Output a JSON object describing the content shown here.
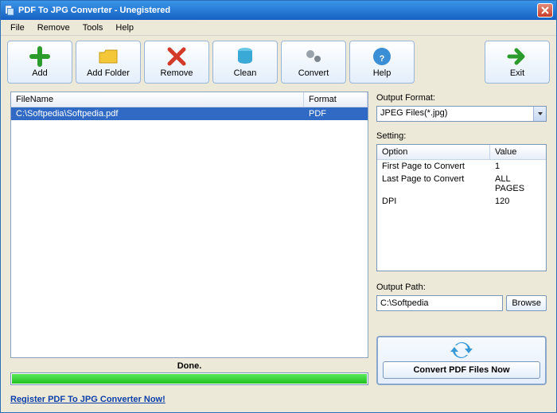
{
  "window": {
    "title": "PDF To JPG Converter - Unegistered"
  },
  "menu": {
    "file": "File",
    "remove": "Remove",
    "tools": "Tools",
    "help": "Help"
  },
  "toolbar": {
    "add": "Add",
    "addFolder": "Add Folder",
    "remove": "Remove",
    "clean": "Clean",
    "convert": "Convert",
    "help": "Help",
    "exit": "Exit"
  },
  "filetable": {
    "headers": {
      "filename": "FileName",
      "format": "Format"
    },
    "rows": [
      {
        "filename": "C:\\Softpedia\\Softpedia.pdf",
        "format": "PDF"
      }
    ]
  },
  "status": "Done.",
  "outputFormat": {
    "label": "Output Format:",
    "value": "JPEG Files(*.jpg)"
  },
  "setting": {
    "label": "Setting:",
    "headers": {
      "option": "Option",
      "value": "Value"
    },
    "rows": [
      {
        "option": "First Page to Convert",
        "value": "1"
      },
      {
        "option": "Last Page to Convert",
        "value": "ALL PAGES"
      },
      {
        "option": "DPI",
        "value": "120"
      }
    ]
  },
  "outputPath": {
    "label": "Output Path:",
    "value": "C:\\Softpedia",
    "browse": "Browse"
  },
  "convertNow": "Convert PDF Files Now",
  "footer": {
    "register": "Register PDF To JPG Converter Now!"
  }
}
